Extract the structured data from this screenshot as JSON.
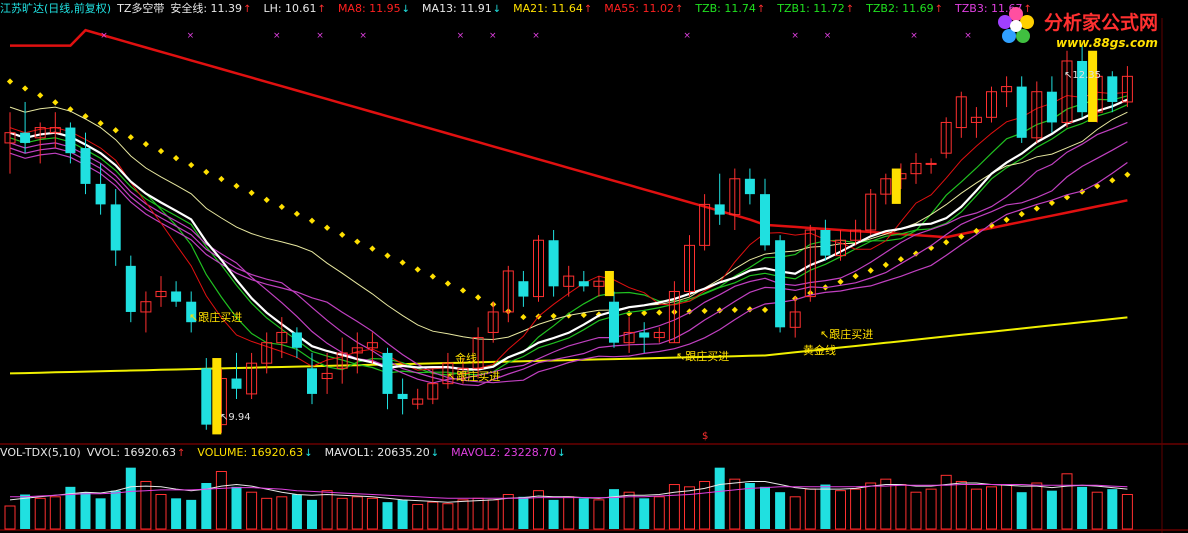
{
  "main_legend": {
    "stock": "江苏旷达(日线,前复权)",
    "indicator": "TZ多空带",
    "items": [
      {
        "label": "安全线: 11.39",
        "arrow": "↑",
        "color": "#e8e8e8"
      },
      {
        "label": "LH: 10.61",
        "arrow": "↑",
        "color": "#e8e8e8"
      },
      {
        "label": "MA8: 11.95",
        "arrow": "↓",
        "color": "#ff2020"
      },
      {
        "label": "MA13: 11.91",
        "arrow": "↓",
        "color": "#e8e8e8"
      },
      {
        "label": "MA21: 11.64",
        "arrow": "↑",
        "color": "#ffe000"
      },
      {
        "label": "MA55: 11.02",
        "arrow": "↑",
        "color": "#ff2020"
      },
      {
        "label": "TZB: 11.74",
        "arrow": "↑",
        "color": "#20e020"
      },
      {
        "label": "TZB1: 11.72",
        "arrow": "↑",
        "color": "#20e020"
      },
      {
        "label": "TZB2: 11.69",
        "arrow": "↑",
        "color": "#20e020"
      },
      {
        "label": "TZB3: 11.67",
        "arrow": "↑",
        "color": "#e040e0"
      }
    ]
  },
  "vol_legend": {
    "name": "VOL-TDX(5,10)",
    "items": [
      {
        "label": "VVOL: 16920.63",
        "arrow": "↑",
        "color": "#e8e8e8"
      },
      {
        "label": "VOLUME: 16920.63",
        "arrow": "↓",
        "color": "#ffe000"
      },
      {
        "label": "MAVOL1: 20635.20",
        "arrow": "↓",
        "color": "#e8e8e8"
      },
      {
        "label": "MAVOL2: 23228.70",
        "arrow": "↓",
        "color": "#e040e0"
      }
    ]
  },
  "logo": {
    "name": "分析家公式网",
    "url": "www.88gs.com"
  },
  "annotations": {
    "buy1": "跟庄买进",
    "buy2": "跟庄买进",
    "buy3": "跟庄买进",
    "buy4": "跟庄买进",
    "gold1": "金线",
    "gold2": "黄金线",
    "low_price": "9.94",
    "high_price": "12.35",
    "dollar": "$"
  },
  "colors": {
    "up": "#ff3030",
    "down": "#20e0e0",
    "ma55": "#e01010",
    "safety": "#f0f000",
    "dots": "#ffe000",
    "white": "#ffffff",
    "ribbon_green": "#20c020",
    "ribbon_purple": "#c040c0",
    "signal": "#ffe000"
  },
  "chart_data": {
    "type": "candlestick",
    "price_range": [
      9.5,
      13.2
    ],
    "candles": [
      {
        "o": 11.8,
        "h": 12.1,
        "l": 11.5,
        "c": 11.9
      },
      {
        "o": 11.9,
        "h": 12.2,
        "l": 11.7,
        "c": 11.8
      },
      {
        "o": 11.85,
        "h": 12.0,
        "l": 11.6,
        "c": 11.95
      },
      {
        "o": 11.9,
        "h": 12.1,
        "l": 11.75,
        "c": 11.95
      },
      {
        "o": 11.95,
        "h": 12.0,
        "l": 11.6,
        "c": 11.7
      },
      {
        "o": 11.75,
        "h": 11.9,
        "l": 11.3,
        "c": 11.4
      },
      {
        "o": 11.4,
        "h": 11.6,
        "l": 11.1,
        "c": 11.2
      },
      {
        "o": 11.2,
        "h": 11.35,
        "l": 10.6,
        "c": 10.75
      },
      {
        "o": 10.6,
        "h": 10.7,
        "l": 10.05,
        "c": 10.15
      },
      {
        "o": 10.15,
        "h": 10.35,
        "l": 9.95,
        "c": 10.25
      },
      {
        "o": 10.3,
        "h": 10.5,
        "l": 10.2,
        "c": 10.35
      },
      {
        "o": 10.35,
        "h": 10.45,
        "l": 10.2,
        "c": 10.25
      },
      {
        "o": 10.25,
        "h": 10.35,
        "l": 9.95,
        "c": 10.05
      },
      {
        "o": 9.6,
        "h": 9.7,
        "l": 9.0,
        "c": 9.05
      },
      {
        "o": 9.05,
        "h": 9.6,
        "l": 8.97,
        "c": 9.5
      },
      {
        "o": 9.5,
        "h": 9.75,
        "l": 9.3,
        "c": 9.4
      },
      {
        "o": 9.35,
        "h": 9.75,
        "l": 9.3,
        "c": 9.65
      },
      {
        "o": 9.65,
        "h": 9.95,
        "l": 9.55,
        "c": 9.85
      },
      {
        "o": 9.85,
        "h": 10.1,
        "l": 9.7,
        "c": 9.95
      },
      {
        "o": 9.95,
        "h": 10.0,
        "l": 9.7,
        "c": 9.8
      },
      {
        "o": 9.6,
        "h": 9.75,
        "l": 9.25,
        "c": 9.35
      },
      {
        "o": 9.5,
        "h": 9.75,
        "l": 9.35,
        "c": 9.55
      },
      {
        "o": 9.6,
        "h": 9.9,
        "l": 9.45,
        "c": 9.75
      },
      {
        "o": 9.75,
        "h": 9.95,
        "l": 9.55,
        "c": 9.8
      },
      {
        "o": 9.8,
        "h": 9.95,
        "l": 9.65,
        "c": 9.85
      },
      {
        "o": 9.75,
        "h": 9.8,
        "l": 9.2,
        "c": 9.35
      },
      {
        "o": 9.35,
        "h": 9.5,
        "l": 9.15,
        "c": 9.3
      },
      {
        "o": 9.25,
        "h": 9.4,
        "l": 9.2,
        "c": 9.3
      },
      {
        "o": 9.3,
        "h": 9.6,
        "l": 9.25,
        "c": 9.45
      },
      {
        "o": 9.45,
        "h": 9.75,
        "l": 9.4,
        "c": 9.65
      },
      {
        "o": 9.55,
        "h": 9.7,
        "l": 9.45,
        "c": 9.6
      },
      {
        "o": 9.6,
        "h": 10.0,
        "l": 9.5,
        "c": 9.9
      },
      {
        "o": 9.95,
        "h": 10.25,
        "l": 9.85,
        "c": 10.15
      },
      {
        "o": 10.15,
        "h": 10.6,
        "l": 10.05,
        "c": 10.55
      },
      {
        "o": 10.45,
        "h": 10.55,
        "l": 10.2,
        "c": 10.3
      },
      {
        "o": 10.3,
        "h": 10.9,
        "l": 10.25,
        "c": 10.85
      },
      {
        "o": 10.85,
        "h": 10.95,
        "l": 10.3,
        "c": 10.4
      },
      {
        "o": 10.4,
        "h": 10.6,
        "l": 10.3,
        "c": 10.5
      },
      {
        "o": 10.45,
        "h": 10.55,
        "l": 10.35,
        "c": 10.4
      },
      {
        "o": 10.4,
        "h": 10.5,
        "l": 10.3,
        "c": 10.45
      },
      {
        "o": 10.25,
        "h": 10.35,
        "l": 9.8,
        "c": 9.85
      },
      {
        "o": 9.85,
        "h": 10.1,
        "l": 9.75,
        "c": 9.95
      },
      {
        "o": 9.95,
        "h": 10.05,
        "l": 9.75,
        "c": 9.9
      },
      {
        "o": 9.9,
        "h": 10.0,
        "l": 9.85,
        "c": 9.95
      },
      {
        "o": 9.85,
        "h": 10.45,
        "l": 9.85,
        "c": 10.35
      },
      {
        "o": 10.35,
        "h": 10.9,
        "l": 10.3,
        "c": 10.8
      },
      {
        "o": 10.8,
        "h": 11.3,
        "l": 10.75,
        "c": 11.2
      },
      {
        "o": 11.2,
        "h": 11.5,
        "l": 11.0,
        "c": 11.1
      },
      {
        "o": 11.1,
        "h": 11.55,
        "l": 10.95,
        "c": 11.45
      },
      {
        "o": 11.45,
        "h": 11.55,
        "l": 11.2,
        "c": 11.3
      },
      {
        "o": 11.3,
        "h": 11.45,
        "l": 10.75,
        "c": 10.8
      },
      {
        "o": 10.85,
        "h": 10.9,
        "l": 9.95,
        "c": 10.0
      },
      {
        "o": 10.0,
        "h": 10.3,
        "l": 9.9,
        "c": 10.15
      },
      {
        "o": 10.3,
        "h": 11.0,
        "l": 10.25,
        "c": 10.95
      },
      {
        "o": 10.95,
        "h": 11.05,
        "l": 10.65,
        "c": 10.7
      },
      {
        "o": 10.7,
        "h": 10.95,
        "l": 10.65,
        "c": 10.85
      },
      {
        "o": 10.85,
        "h": 11.05,
        "l": 10.8,
        "c": 10.95
      },
      {
        "o": 10.95,
        "h": 11.35,
        "l": 10.9,
        "c": 11.3
      },
      {
        "o": 11.3,
        "h": 11.5,
        "l": 11.2,
        "c": 11.45
      },
      {
        "o": 11.45,
        "h": 11.6,
        "l": 11.35,
        "c": 11.5
      },
      {
        "o": 11.5,
        "h": 11.7,
        "l": 11.4,
        "c": 11.6
      },
      {
        "o": 11.6,
        "h": 11.65,
        "l": 11.5,
        "c": 11.6
      },
      {
        "o": 11.7,
        "h": 12.05,
        "l": 11.65,
        "c": 12.0
      },
      {
        "o": 11.95,
        "h": 12.3,
        "l": 11.85,
        "c": 12.25
      },
      {
        "o": 12.0,
        "h": 12.15,
        "l": 11.85,
        "c": 12.05
      },
      {
        "o": 12.05,
        "h": 12.35,
        "l": 12.0,
        "c": 12.3
      },
      {
        "o": 12.3,
        "h": 12.45,
        "l": 12.15,
        "c": 12.35
      },
      {
        "o": 12.35,
        "h": 12.45,
        "l": 11.8,
        "c": 11.85
      },
      {
        "o": 11.85,
        "h": 12.4,
        "l": 11.8,
        "c": 12.3
      },
      {
        "o": 12.3,
        "h": 12.45,
        "l": 11.9,
        "c": 12.0
      },
      {
        "o": 12.0,
        "h": 12.7,
        "l": 11.95,
        "c": 12.6
      },
      {
        "o": 12.6,
        "h": 12.75,
        "l": 12.05,
        "c": 12.1
      },
      {
        "o": 12.1,
        "h": 12.5,
        "l": 12.0,
        "c": 12.45
      },
      {
        "o": 12.45,
        "h": 12.5,
        "l": 12.1,
        "c": 12.2
      },
      {
        "o": 12.2,
        "h": 12.55,
        "l": 12.15,
        "c": 12.45
      }
    ],
    "volume": [
      30,
      45,
      40,
      42,
      55,
      48,
      40,
      50,
      80,
      62,
      45,
      40,
      38,
      60,
      75,
      55,
      48,
      40,
      42,
      45,
      38,
      50,
      40,
      42,
      40,
      35,
      38,
      32,
      35,
      33,
      38,
      40,
      38,
      45,
      42,
      50,
      38,
      42,
      40,
      38,
      52,
      48,
      40,
      42,
      58,
      55,
      62,
      80,
      65,
      60,
      55,
      48,
      42,
      52,
      58,
      50,
      52,
      60,
      65,
      58,
      48,
      52,
      70,
      62,
      52,
      55,
      58,
      48,
      60,
      50,
      72,
      55,
      48,
      52,
      45
    ],
    "mavol1": [
      38,
      40,
      42,
      44,
      46,
      48,
      47,
      50,
      55,
      56,
      55,
      52,
      50,
      52,
      56,
      58,
      56,
      52,
      48,
      45,
      44,
      45,
      44,
      43,
      42,
      40,
      38,
      37,
      36,
      35,
      36,
      37,
      38,
      40,
      41,
      43,
      42,
      42,
      41,
      40,
      42,
      44,
      44,
      45,
      48,
      50,
      53,
      58,
      60,
      62,
      62,
      58,
      54,
      52,
      52,
      52,
      53,
      56,
      58,
      58,
      56,
      56,
      58,
      60,
      60,
      58,
      57,
      56,
      56,
      54,
      56,
      57,
      56,
      54,
      52
    ],
    "mavol2": [
      42,
      42,
      43,
      44,
      45,
      46,
      46,
      47,
      49,
      50,
      51,
      51,
      51,
      52,
      53,
      54,
      54,
      53,
      52,
      50,
      49,
      48,
      47,
      46,
      45,
      44,
      43,
      42,
      41,
      40,
      40,
      40,
      40,
      40,
      40,
      41,
      41,
      41,
      41,
      41,
      41,
      42,
      42,
      43,
      44,
      45,
      47,
      49,
      51,
      53,
      54,
      55,
      55,
      55,
      55,
      55,
      55,
      56,
      56,
      57,
      57,
      57,
      57,
      58,
      58,
      58,
      58,
      58,
      57,
      57,
      57,
      57,
      57,
      56,
      55
    ],
    "buy_signal_bars": [
      13,
      39,
      58,
      71
    ]
  }
}
